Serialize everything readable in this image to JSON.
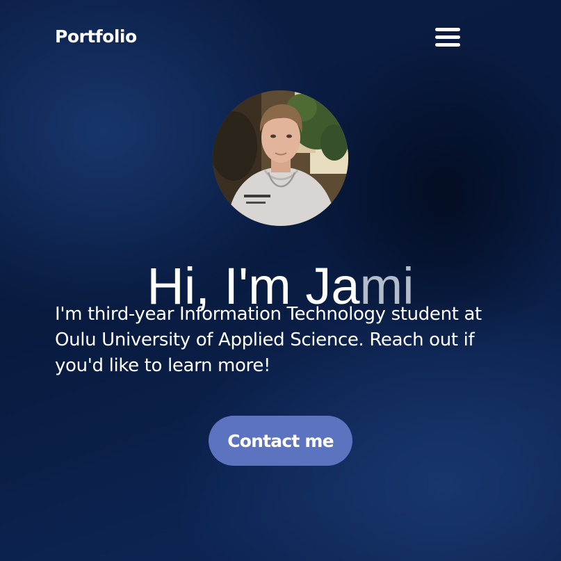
{
  "header": {
    "logo_text": "Portfolio",
    "menu_icon": "hamburger-menu-icon"
  },
  "hero": {
    "greeting_prefix": "Hi, I'm ",
    "greeting_name_part1": "Ja",
    "greeting_name_part2": "mi",
    "description": "I'm third-year Information Technology student at Oulu University of Applied Science. Reach out if you'd like to learn more!",
    "contact_button_label": "Contact me"
  },
  "colors": {
    "background": "#0b1f49",
    "button": "#5c73c0",
    "text": "#ffffff",
    "faded_text": "#b3bccb"
  }
}
